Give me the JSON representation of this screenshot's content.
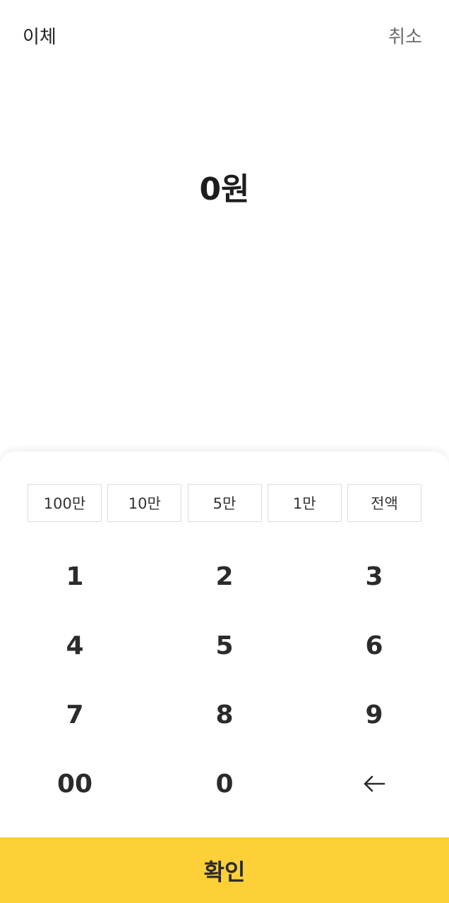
{
  "header": {
    "title": "이체",
    "cancel_label": "취소"
  },
  "amount": {
    "display": "0원"
  },
  "quick_amounts": [
    "100만",
    "10만",
    "5만",
    "1만",
    "전액"
  ],
  "keypad": {
    "keys": [
      "1",
      "2",
      "3",
      "4",
      "5",
      "6",
      "7",
      "8",
      "9",
      "00",
      "0"
    ],
    "backspace_icon": "left-arrow-icon"
  },
  "confirm": {
    "label": "확인"
  },
  "colors": {
    "confirm_bg": "#fdd037",
    "cancel_text": "#6b6b6b"
  }
}
